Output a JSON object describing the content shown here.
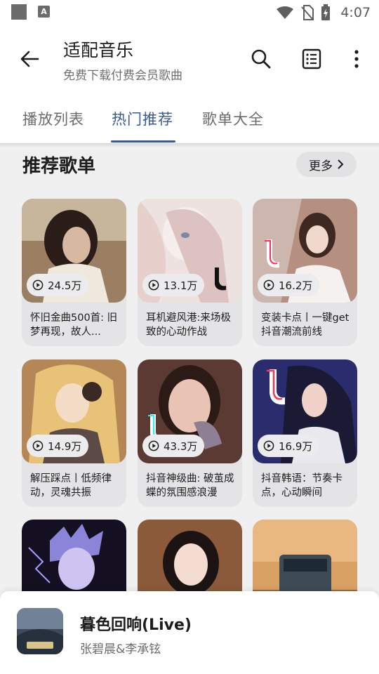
{
  "status_bar": {
    "time": "4:07"
  },
  "header": {
    "title": "适配音乐",
    "subtitle": "免费下载付费会员歌曲",
    "icons": [
      "back-arrow-icon",
      "search-icon",
      "list-icon",
      "more-vert-icon"
    ]
  },
  "tabs": [
    {
      "label": "播放列表",
      "active": false
    },
    {
      "label": "热门推荐",
      "active": true
    },
    {
      "label": "歌单大全",
      "active": false
    }
  ],
  "section": {
    "title": "推荐歌单",
    "more_label": "更多"
  },
  "playlists": [
    {
      "plays": "24.5万",
      "title": "怀旧金曲500首: 旧梦再现，故人..."
    },
    {
      "plays": "13.1万",
      "title": "耳机避风港:来场极致的心动作战"
    },
    {
      "plays": "16.2万",
      "title": "变装卡点丨一键get抖音潮流前线"
    },
    {
      "plays": "14.9万",
      "title": "解压踩点丨低频律动，灵魂共振"
    },
    {
      "plays": "43.3万",
      "title": "抖音神级曲: 破茧成蝶的氛围感浪漫"
    },
    {
      "plays": "16.9万",
      "title": "抖音韩语：节奏卡点，心动瞬间"
    }
  ],
  "now_playing": {
    "song": "暮色回响(Live)",
    "artist": "张碧晨&李承铉"
  },
  "colors": {
    "accent": "#3a5a92",
    "card_bg": "#e4e4e7",
    "page_bg": "#f0f0f0"
  }
}
